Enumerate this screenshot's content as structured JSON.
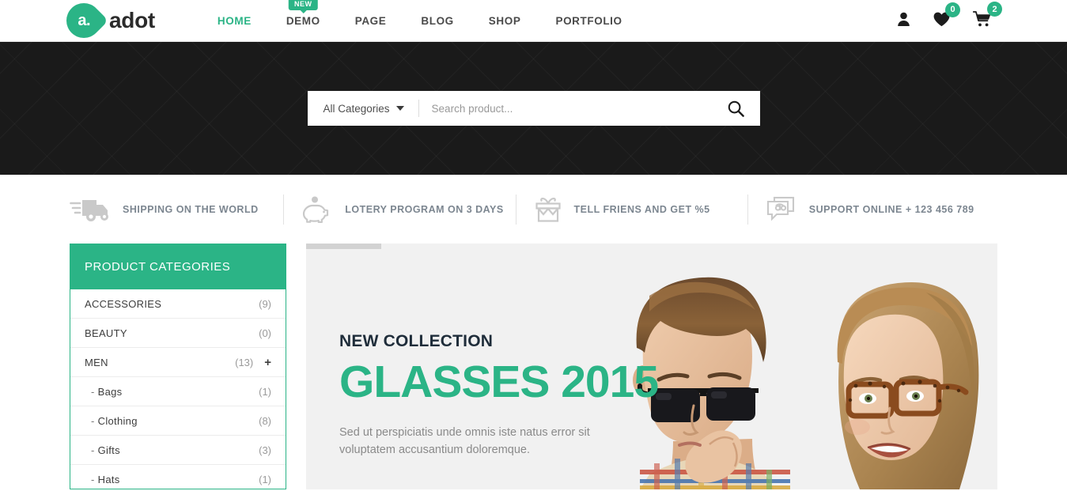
{
  "brand": {
    "mark_text": "a.",
    "name": "adot",
    "accent": "#2bb486"
  },
  "nav": {
    "items": [
      {
        "label": "HOME",
        "active": true
      },
      {
        "label": "DEMO",
        "active": false,
        "badge": "NEW"
      },
      {
        "label": "PAGE",
        "active": false
      },
      {
        "label": "BLOG",
        "active": false
      },
      {
        "label": "SHOP",
        "active": false
      },
      {
        "label": "PORTFOLIO",
        "active": false
      }
    ]
  },
  "header_icons": {
    "account": {
      "icon": "user-icon"
    },
    "wishlist": {
      "icon": "heart-icon",
      "count": "0"
    },
    "cart": {
      "icon": "cart-icon",
      "count": "2"
    }
  },
  "search": {
    "category_label": "All Categories",
    "placeholder": "Search product...",
    "value": "",
    "submit_icon": "search-icon"
  },
  "services": [
    {
      "icon": "truck-icon",
      "label": "SHIPPING ON THE WORLD"
    },
    {
      "icon": "piggy-bank-icon",
      "label": "LOTERY PROGRAM ON 3 DAYS"
    },
    {
      "icon": "gift-icon",
      "label": "TELL FRIENS AND GET %5"
    },
    {
      "icon": "support-phone-icon",
      "label": "SUPPORT ONLINE + 123 456 789"
    }
  ],
  "sidebar": {
    "title": "PRODUCT CATEGORIES",
    "categories": [
      {
        "name": "ACCESSORIES",
        "count": "(9)",
        "sub": false,
        "expandable": false
      },
      {
        "name": "BEAUTY",
        "count": "(0)",
        "sub": false,
        "expandable": false
      },
      {
        "name": "MEN",
        "count": "(13)",
        "sub": false,
        "expandable": true,
        "expand_icon": "plus-icon"
      },
      {
        "name": "Bags",
        "count": "(1)",
        "sub": true,
        "expandable": false
      },
      {
        "name": "Clothing",
        "count": "(8)",
        "sub": true,
        "expandable": false
      },
      {
        "name": "Gifts",
        "count": "(3)",
        "sub": true,
        "expandable": false
      },
      {
        "name": "Hats",
        "count": "(1)",
        "sub": true,
        "expandable": false
      }
    ]
  },
  "slider": {
    "kicker": "NEW COLLECTION",
    "title": "GLASSES 2015",
    "description": "Sed ut perspiciatis unde omnis iste natus error sit voluptatem accusantium doloremque.",
    "progress_percent": 10
  }
}
